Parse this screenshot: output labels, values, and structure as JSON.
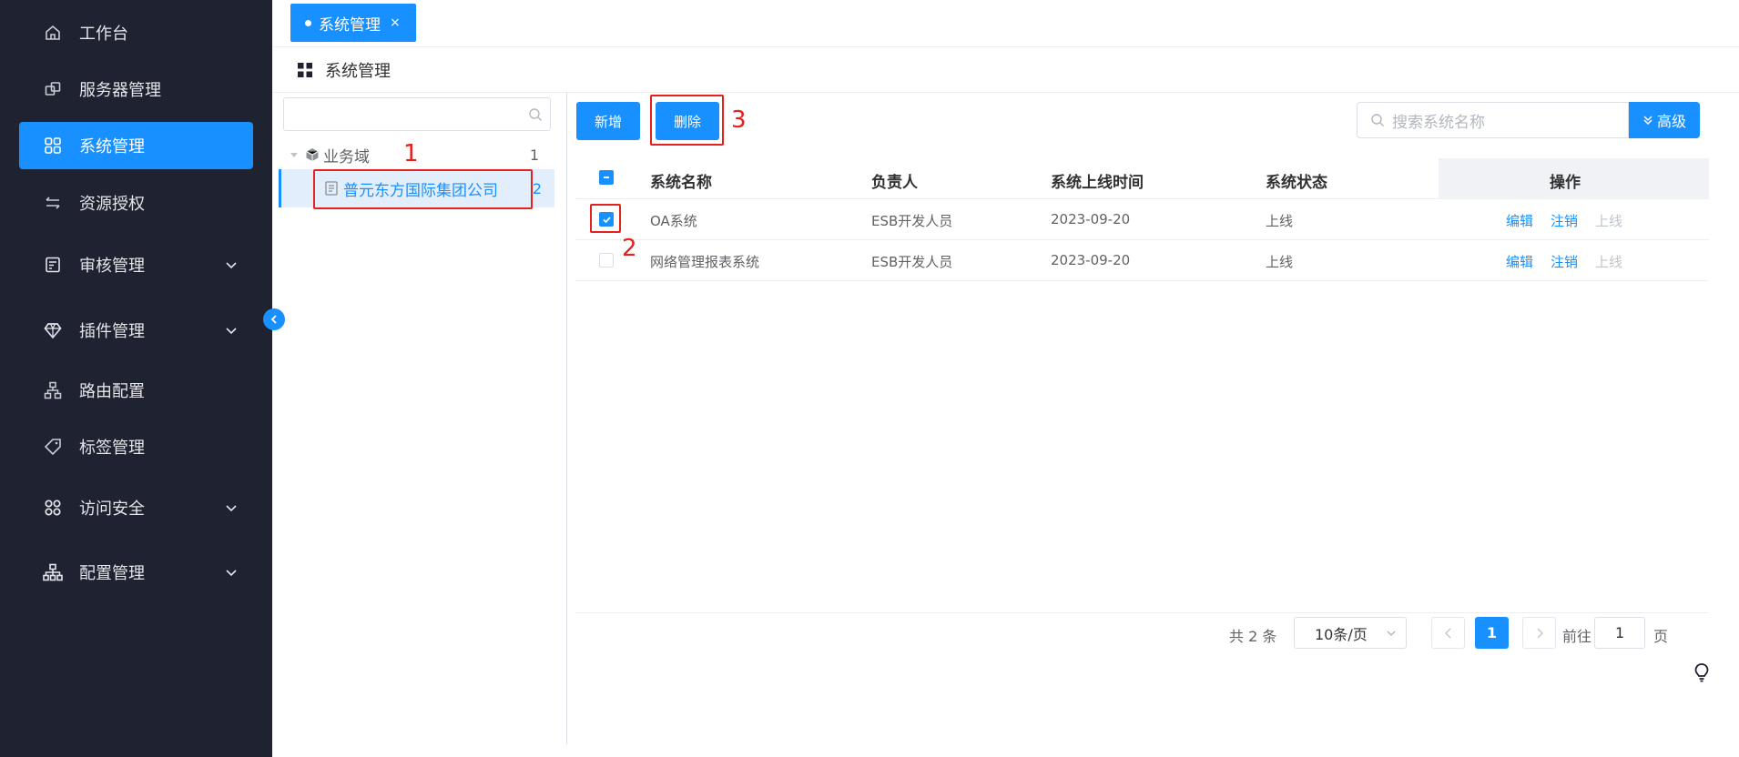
{
  "sidebar": {
    "items": [
      {
        "label": "工作台",
        "icon": "home-icon"
      },
      {
        "label": "服务器管理",
        "icon": "server-icon"
      },
      {
        "label": "系统管理",
        "icon": "apps-grid-icon",
        "active": true
      },
      {
        "label": "资源授权",
        "icon": "transfer-icon"
      },
      {
        "label": "审核管理",
        "icon": "audit-icon",
        "expandable": true
      },
      {
        "label": "插件管理",
        "icon": "diamond-icon",
        "expandable": true
      },
      {
        "label": "路由配置",
        "icon": "route-icon"
      },
      {
        "label": "标签管理",
        "icon": "tag-icon"
      },
      {
        "label": "访问安全",
        "icon": "security-grid-icon",
        "expandable": true
      },
      {
        "label": "配置管理",
        "icon": "org-chart-icon",
        "expandable": true
      }
    ]
  },
  "tabs": [
    {
      "label": "系统管理",
      "close": "×"
    }
  ],
  "page": {
    "title": "系统管理"
  },
  "tree": {
    "search_value": "",
    "root": {
      "label": "业务域",
      "count": "1"
    },
    "child": {
      "label": "普元东方国际集团公司",
      "count": "2"
    }
  },
  "toolbar": {
    "add_label": "新增",
    "delete_label": "删除",
    "search_placeholder": "搜索系统名称",
    "advanced_label": "高级"
  },
  "annotations": [
    "1",
    "2",
    "3"
  ],
  "table": {
    "columns": [
      "系统名称",
      "负责人",
      "系统上线时间",
      "系统状态",
      "操作"
    ],
    "rows": [
      {
        "name": "OA系统",
        "owner": "ESB开发人员",
        "date": "2023-09-20",
        "status": "上线",
        "checked": true,
        "ops": [
          "编辑",
          "注销",
          "上线"
        ]
      },
      {
        "name": "网络管理报表系统",
        "owner": "ESB开发人员",
        "date": "2023-09-20",
        "status": "上线",
        "checked": false,
        "ops": [
          "编辑",
          "注销",
          "上线"
        ]
      }
    ]
  },
  "pagination": {
    "total": "共 2 条",
    "page_size": "10条/页",
    "current_page": "1",
    "goto_label": "前往",
    "goto_value": "1",
    "page_unit": "页"
  },
  "colors": {
    "primary": "#1890ff",
    "sidebar_bg": "#1f2230",
    "annotation": "#e4211c"
  }
}
